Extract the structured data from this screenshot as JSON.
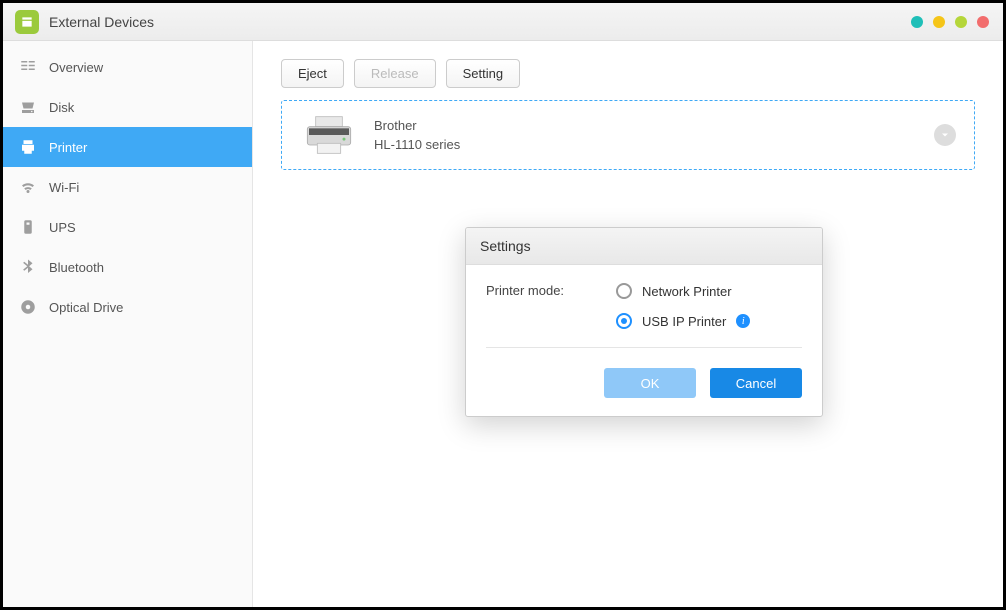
{
  "window": {
    "title": "External Devices"
  },
  "sidebar": {
    "items": [
      {
        "label": "Overview",
        "icon": "overview"
      },
      {
        "label": "Disk",
        "icon": "disk"
      },
      {
        "label": "Printer",
        "icon": "printer",
        "active": true
      },
      {
        "label": "Wi-Fi",
        "icon": "wifi"
      },
      {
        "label": "UPS",
        "icon": "ups"
      },
      {
        "label": "Bluetooth",
        "icon": "bluetooth"
      },
      {
        "label": "Optical Drive",
        "icon": "optical"
      }
    ]
  },
  "toolbar": {
    "eject": "Eject",
    "release": "Release",
    "setting": "Setting"
  },
  "device": {
    "brand": "Brother",
    "model": "HL-1110 series"
  },
  "modal": {
    "title": "Settings",
    "field_label": "Printer mode:",
    "options": {
      "network": "Network Printer",
      "usbip": "USB IP Printer"
    },
    "selected": "usbip",
    "ok": "OK",
    "cancel": "Cancel"
  }
}
